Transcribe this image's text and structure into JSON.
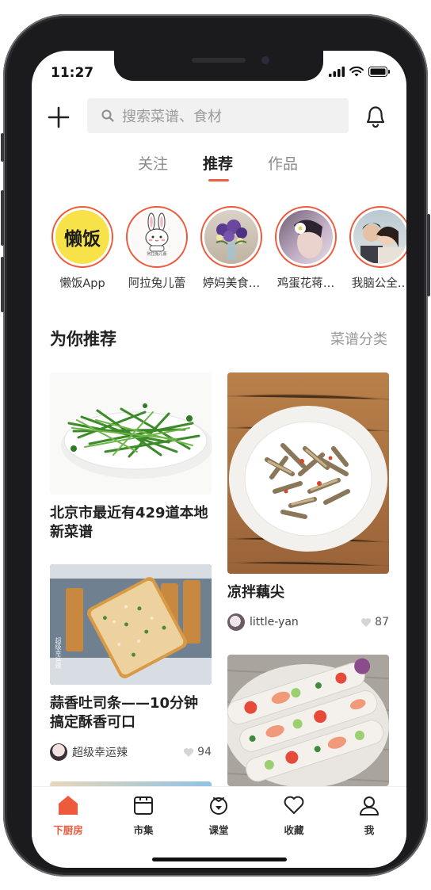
{
  "status_bar": {
    "time": "11:27"
  },
  "search": {
    "placeholder": "搜索菜谱、食材"
  },
  "tabs": [
    {
      "label": "关注",
      "active": false
    },
    {
      "label": "推荐",
      "active": true
    },
    {
      "label": "作品",
      "active": false
    }
  ],
  "stories": [
    {
      "name": "懒饭App",
      "avatar_text": "懒饭"
    },
    {
      "name": "阿拉兔儿蕾",
      "avatar_text": "阿拉兔儿蕾"
    },
    {
      "name": "婷妈美食…"
    },
    {
      "name": "鸡蛋花蒋…"
    },
    {
      "name": "我脑公全…"
    }
  ],
  "section": {
    "title": "为你推荐",
    "link": "菜谱分类"
  },
  "feed": {
    "left": [
      {
        "title": "北京市最近有429道本地新菜谱"
      },
      {
        "title": "蒜香吐司条——10分钟搞定酥香可口",
        "author": "超级幸运辣",
        "likes": "94",
        "image_caption": "超级幸运辣"
      }
    ],
    "right": [
      {
        "title": "凉拌藕尖",
        "author": "little-yan",
        "likes": "87"
      },
      {
        "title": ""
      }
    ]
  },
  "bottom_nav": [
    {
      "label": "下厨房",
      "icon": "home-icon",
      "active": true
    },
    {
      "label": "市集",
      "icon": "market-icon",
      "active": false
    },
    {
      "label": "课堂",
      "icon": "class-icon",
      "active": false
    },
    {
      "label": "收藏",
      "icon": "heart-icon",
      "active": false
    },
    {
      "label": "我",
      "icon": "profile-icon",
      "active": false
    }
  ],
  "colors": {
    "accent": "#ee5a3c",
    "text": "#222222",
    "muted": "#999999"
  }
}
